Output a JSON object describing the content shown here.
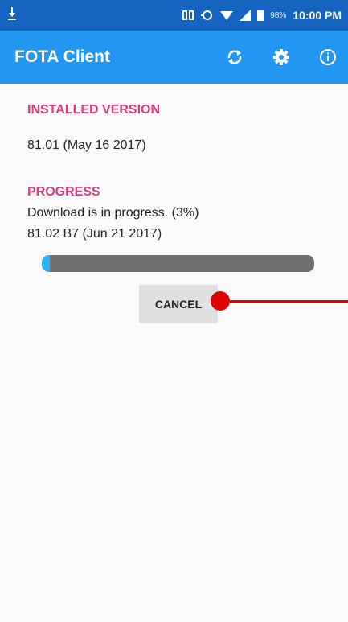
{
  "status_bar": {
    "time": "10:00 PM",
    "battery_percent": "98%",
    "icons": [
      "download-icon",
      "nfc-icon",
      "data-sync-icon",
      "wifi-icon",
      "signal-icon",
      "battery-icon"
    ]
  },
  "app_bar": {
    "title": "FOTA Client",
    "actions": [
      "sync-icon",
      "settings-icon",
      "info-icon"
    ]
  },
  "installed": {
    "title": "INSTALLED VERSION",
    "version": "81.01 (May 16 2017)"
  },
  "progress": {
    "title": "PROGRESS",
    "status": "Download is in progress. (3%)",
    "target": "81.02 B7 (Jun 21 2017)",
    "percent": 3
  },
  "cancel_label": "CANCEL",
  "colors": {
    "status_bar": "#1565c0",
    "app_bar": "#2196f3",
    "section_title": "#e03a7a",
    "progress_fill": "#29b6f6",
    "progress_track": "#6f6f6f",
    "touch_marker": "#e00000"
  }
}
